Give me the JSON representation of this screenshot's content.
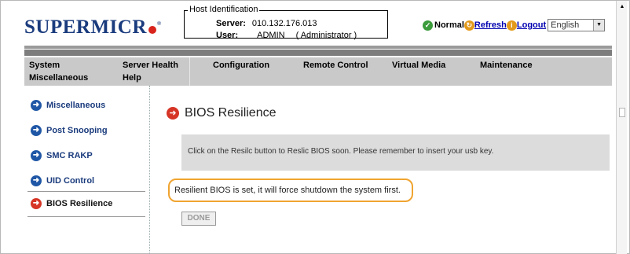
{
  "header": {
    "logo_text": "SUPERMICR",
    "logo_registered": "®",
    "host_identification": {
      "title": "Host Identification",
      "server_label": "Server:",
      "server_value": "010.132.176.013",
      "user_label": "User:",
      "user_value": "ADMIN",
      "user_role": "( Administrator )"
    },
    "status": {
      "normal_label": "Normal",
      "refresh_label": "Refresh",
      "logout_label": "Logout",
      "language_value": "English"
    }
  },
  "nav": {
    "row1": [
      "System",
      "Server Health",
      "Configuration",
      "Remote Control",
      "Virtual Media",
      "Maintenance"
    ],
    "row2": [
      "Miscellaneous",
      "Help"
    ]
  },
  "sidebar": {
    "items": [
      {
        "label": "Miscellaneous",
        "icon": "arrow-right-icon",
        "active": false
      },
      {
        "label": "Post Snooping",
        "icon": "arrow-right-icon",
        "active": false
      },
      {
        "label": "SMC RAKP",
        "icon": "arrow-right-icon",
        "active": false
      },
      {
        "label": "UID Control",
        "icon": "arrow-right-icon",
        "active": false
      },
      {
        "label": "BIOS Resilience",
        "icon": "arrow-right-icon",
        "active": true
      }
    ]
  },
  "main": {
    "title": "BIOS Resilience",
    "info_text": "Click on the Resilc button to Reslic BIOS soon. Please remember to insert your usb key.",
    "message": "Resilient BIOS is set, it will force shutdown the system first.",
    "done_label": "DONE"
  },
  "colors": {
    "logo_blue": "#1a3b7d",
    "accent_red": "#d63526",
    "highlight_orange": "#f0a430",
    "nav_gray": "#c9c9c9"
  }
}
